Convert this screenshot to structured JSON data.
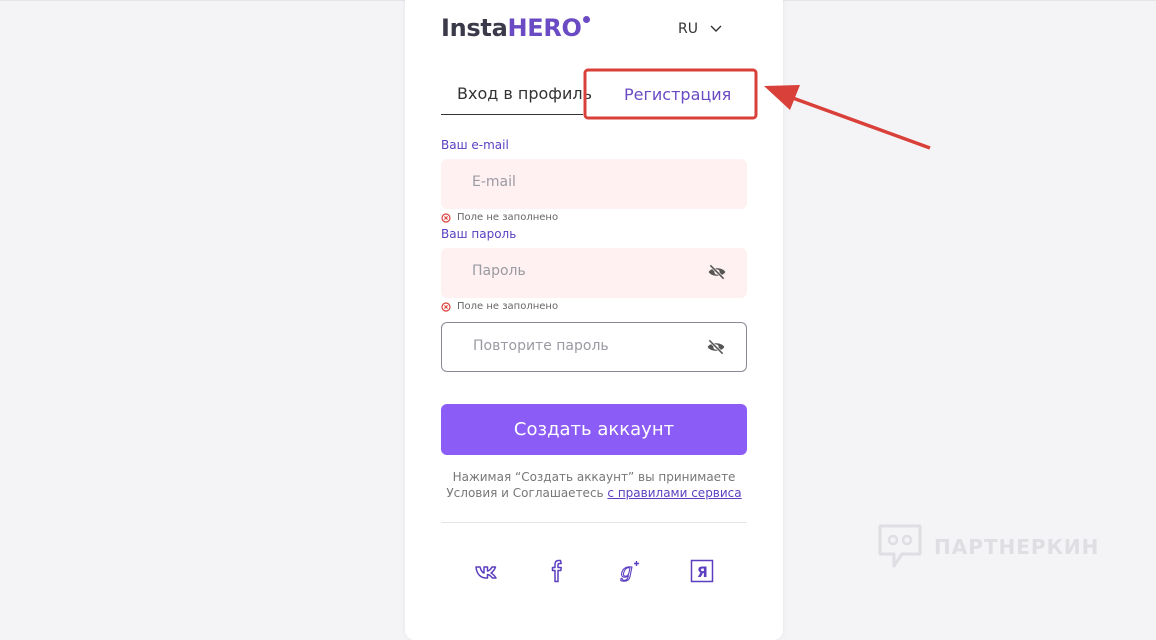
{
  "header": {
    "logo_part1": "Insta",
    "logo_part2": "HERO",
    "language": "RU"
  },
  "tabs": {
    "login_label": "Вход в профиль",
    "register_label": "Регистрация",
    "active": "register"
  },
  "form": {
    "email_label": "Ваш e-mail",
    "email_placeholder": "E-mail",
    "email_error": "Поле не заполнено",
    "password_label": "Ваш пароль",
    "password_placeholder": "Пароль",
    "password_error": "Поле не заполнено",
    "repeat_placeholder": "Повторите пароль",
    "submit_label": "Создать аккаунт"
  },
  "terms": {
    "line1": "Нажимая “Создать аккаунт” вы принимаете",
    "line2_prefix": "Условия и Соглашаетесь ",
    "link_text": "с правилами сервиса"
  },
  "social": [
    "vk-icon",
    "facebook-icon",
    "google-plus-icon",
    "yandex-icon"
  ],
  "watermark": "ПАРТНЕРКИН",
  "colors": {
    "accent": "#8c5cf6",
    "brand": "#6a4bc4",
    "error_field_bg": "#fff1f1",
    "annotation": "#d9403a"
  }
}
